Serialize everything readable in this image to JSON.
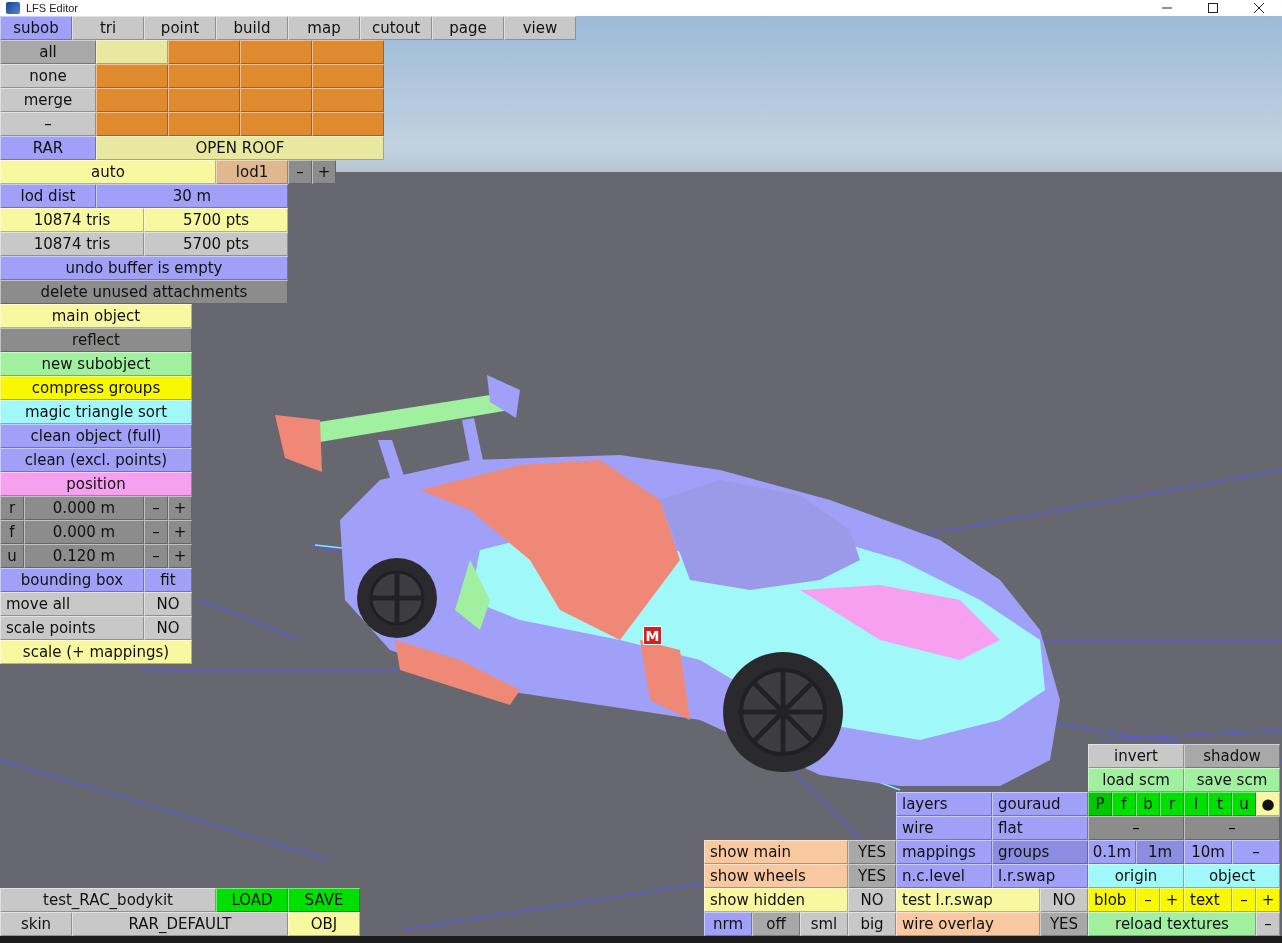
{
  "window": {
    "title": "LFS Editor"
  },
  "mode_tabs": [
    {
      "label": "subob",
      "selected": true
    },
    {
      "label": "tri",
      "selected": false
    },
    {
      "label": "point",
      "selected": false
    },
    {
      "label": "build",
      "selected": false
    },
    {
      "label": "map",
      "selected": false
    },
    {
      "label": "cutout",
      "selected": false
    },
    {
      "label": "page",
      "selected": false
    },
    {
      "label": "view",
      "selected": false
    }
  ],
  "left_panel": {
    "rows": [
      [
        {
          "text": "all",
          "color": "#a8a8a8"
        },
        {
          "color": "#e8e8a0"
        },
        {
          "color": "#e08a30"
        },
        {
          "color": "#e08a30"
        },
        {
          "color": "#e08a30"
        }
      ],
      [
        {
          "text": "none",
          "color": "#c8c8c8"
        },
        {
          "color": "#e08a30"
        },
        {
          "color": "#e08a30"
        },
        {
          "color": "#e08a30"
        },
        {
          "color": "#e08a30"
        }
      ],
      [
        {
          "text": "merge",
          "color": "#c8c8c8"
        },
        {
          "color": "#e08a30"
        },
        {
          "color": "#e08a30"
        },
        {
          "color": "#e08a30"
        },
        {
          "color": "#e08a30"
        }
      ],
      [
        {
          "text": "–",
          "color": "#c8c8c8"
        },
        {
          "color": "#e08a30"
        },
        {
          "color": "#e08a30"
        },
        {
          "color": "#e08a30"
        },
        {
          "color": "#e08a30"
        }
      ],
      [
        {
          "text": "RAR",
          "color": "#a0a0f8"
        },
        {
          "text": "OPEN ROOF",
          "color": "#e8e8a0"
        }
      ],
      [
        {
          "text": "auto",
          "color": "#f8f8a0"
        },
        {
          "text": "lod1",
          "color": "#e0b890"
        },
        {
          "text": "–",
          "color": "#8c8c8c"
        },
        {
          "text": "+",
          "color": "#8c8c8c"
        }
      ],
      [
        {
          "text": "lod dist",
          "color": "#a0a0f8"
        },
        {
          "text": "30 m",
          "color": "#a0a0f8"
        }
      ],
      [
        {
          "text": "10874 tris",
          "color": "#f8f8a0"
        },
        {
          "text": "5700 pts",
          "color": "#f8f8a0"
        }
      ],
      [
        {
          "text": "10874 tris",
          "color": "#c8c8c8"
        },
        {
          "text": "5700 pts",
          "color": "#c8c8c8"
        }
      ],
      [
        {
          "text": "undo buffer is empty",
          "color": "#a0a0f8"
        }
      ],
      [
        {
          "text": "delete unused attachments",
          "color": "#8c8c8c"
        }
      ],
      [
        {
          "text": "main object",
          "color": "#f8f8a0"
        }
      ],
      [
        {
          "text": "reflect",
          "color": "#8c8c8c"
        }
      ],
      [
        {
          "text": "new subobject",
          "color": "#a0f0a0"
        }
      ],
      [
        {
          "text": "compress groups",
          "color": "#f8f800"
        }
      ],
      [
        {
          "text": "magic triangle sort",
          "color": "#a0f8f8"
        }
      ],
      [
        {
          "text": "clean object (full)",
          "color": "#a0a0f8"
        }
      ],
      [
        {
          "text": "clean (excl. points)",
          "color": "#a0a0f8"
        }
      ],
      [
        {
          "text": "position",
          "color": "#f8a0f0"
        }
      ],
      [
        {
          "text": "r",
          "color": "#8c8c8c"
        },
        {
          "text": "0.000 m",
          "color": "#8c8c8c"
        },
        {
          "text": "–",
          "color": "#8c8c8c"
        },
        {
          "text": "+",
          "color": "#8c8c8c"
        }
      ],
      [
        {
          "text": "f",
          "color": "#8c8c8c"
        },
        {
          "text": "0.000 m",
          "color": "#8c8c8c"
        },
        {
          "text": "–",
          "color": "#8c8c8c"
        },
        {
          "text": "+",
          "color": "#8c8c8c"
        }
      ],
      [
        {
          "text": "u",
          "color": "#8c8c8c"
        },
        {
          "text": "0.120 m",
          "color": "#8c8c8c"
        },
        {
          "text": "–",
          "color": "#8c8c8c"
        },
        {
          "text": "+",
          "color": "#8c8c8c"
        }
      ],
      [
        {
          "text": "bounding box",
          "color": "#a0a0f8"
        },
        {
          "text": "fit",
          "color": "#a0a0f8"
        }
      ],
      [
        {
          "text": "move all",
          "color": "#c8c8c8"
        },
        {
          "text": "NO",
          "color": "#c8c8c8"
        }
      ],
      [
        {
          "text": "scale points",
          "color": "#c8c8c8"
        },
        {
          "text": "NO",
          "color": "#c8c8c8"
        }
      ],
      [
        {
          "text": "scale (+ mappings)",
          "color": "#f8f8a0"
        }
      ]
    ]
  },
  "file_panel": {
    "rows": [
      [
        {
          "text": "test_RAC_bodykit",
          "color": "#c8c8c8"
        },
        {
          "text": "LOAD",
          "color": "#00e000"
        },
        {
          "text": "SAVE",
          "color": "#00e000"
        }
      ],
      [
        {
          "text": "skin",
          "color": "#c8c8c8"
        },
        {
          "text": "RAR_DEFAULT",
          "color": "#c8c8c8"
        },
        {
          "text": "OBJ",
          "color": "#f8f8a0"
        }
      ]
    ]
  },
  "view_panel": {
    "lines": [
      {
        "buttons": [
          {
            "text": "invert",
            "color": "#c8c8c8"
          },
          {
            "text": "shadow",
            "color": "#a8a8a8"
          }
        ]
      },
      {
        "buttons": [
          {
            "text": "load scm",
            "color": "#a0f0a0"
          },
          {
            "text": "save scm",
            "color": "#a0f0a0"
          }
        ]
      },
      {
        "buttons": [
          {
            "text": "layers",
            "color": "#a0a0f8"
          },
          {
            "text": "gouraud",
            "color": "#a0a0f8"
          },
          {
            "text": "P",
            "color": "#00c800"
          },
          {
            "text": "f",
            "color": "#00e000"
          },
          {
            "text": "b",
            "color": "#00e000"
          },
          {
            "text": "r",
            "color": "#00e000"
          },
          {
            "text": "l",
            "color": "#00e000"
          },
          {
            "text": "t",
            "color": "#00e000"
          },
          {
            "text": "u",
            "color": "#00e000"
          },
          {
            "text": "●",
            "color": "#f8f8a0"
          }
        ]
      },
      {
        "buttons": [
          {
            "text": "wire",
            "color": "#a0a0f8"
          },
          {
            "text": "flat",
            "color": "#a0a0f8"
          },
          {
            "text": "–",
            "color": "#8c8c8c"
          },
          {
            "text": "–",
            "color": "#8c8c8c"
          }
        ]
      },
      {
        "buttons": [
          {
            "text": "show main",
            "color": "#f8c8a0"
          },
          {
            "text": "YES",
            "color": "#a8a8a8"
          },
          {
            "text": "mappings",
            "color": "#a0a0f8"
          },
          {
            "text": "groups",
            "color": "#8c8ce0"
          },
          {
            "text": "0.1m",
            "color": "#a0a0f8"
          },
          {
            "text": "1m",
            "color": "#8c8ce0"
          },
          {
            "text": "10m",
            "color": "#a0a0f8"
          },
          {
            "text": "–",
            "color": "#a0a0f8"
          }
        ]
      },
      {
        "buttons": [
          {
            "text": "show wheels",
            "color": "#f8c8a0"
          },
          {
            "text": "YES",
            "color": "#a8a8a8"
          },
          {
            "text": "n.c.level",
            "color": "#a0a0f8"
          },
          {
            "text": "l.r.swap",
            "color": "#a0a0f8"
          },
          {
            "text": "origin",
            "color": "#a0f8f8"
          },
          {
            "text": "object",
            "color": "#a0f8f8"
          }
        ]
      },
      {
        "buttons": [
          {
            "text": "show hidden",
            "color": "#f8f8a0"
          },
          {
            "text": "NO",
            "color": "#c8c8c8"
          },
          {
            "text": "test l.r.swap",
            "color": "#f8f8a0"
          },
          {
            "text": "NO",
            "color": "#c8c8c8"
          },
          {
            "text": "blob",
            "color": "#f8f800"
          },
          {
            "text": "–",
            "color": "#f8f800"
          },
          {
            "text": "+",
            "color": "#f8f800"
          },
          {
            "text": "text",
            "color": "#f8f800"
          },
          {
            "text": "–",
            "color": "#f8f800"
          },
          {
            "text": "+",
            "color": "#f8f800"
          }
        ]
      },
      {
        "buttons": [
          {
            "text": "nrm",
            "color": "#a0a0f8"
          },
          {
            "text": "off",
            "color": "#a8a8a8"
          },
          {
            "text": "sml",
            "color": "#c8c8c8"
          },
          {
            "text": "big",
            "color": "#c8c8c8"
          },
          {
            "text": "wire overlay",
            "color": "#f8c8a0"
          },
          {
            "text": "YES",
            "color": "#a8a8a8"
          },
          {
            "text": "reload textures",
            "color": "#a0f0a0"
          },
          {
            "text": "–",
            "color": "#c8c8c8"
          }
        ]
      }
    ]
  },
  "viewport": {
    "badge": "M"
  }
}
